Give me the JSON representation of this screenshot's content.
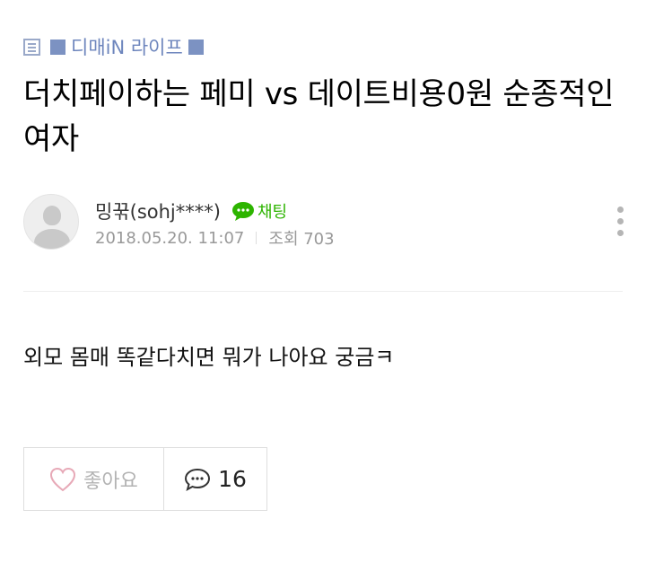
{
  "board": {
    "label": "디매iN 라이프"
  },
  "post": {
    "title": "더치페이하는 페미 vs 데이트비용0원 순종적인 여자",
    "author": "밍꾺(sohj****)",
    "chat_label": "채팅",
    "date": "2018.05.20. 11:07",
    "views": "조회 703",
    "body": "외모 몸매 똑같다치면 뭐가 나아요 궁금ㅋ"
  },
  "actions": {
    "like_label": "좋아요",
    "comment_count": "16"
  },
  "colors": {
    "accent": "#7c92c2",
    "chat_green": "#2db400",
    "meta_gray": "#999999"
  }
}
